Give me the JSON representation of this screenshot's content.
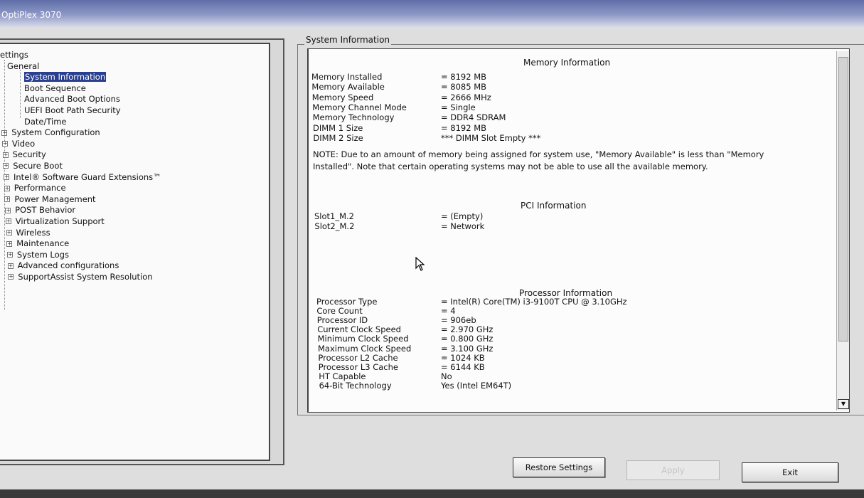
{
  "window": {
    "title": "OptiPlex 3070"
  },
  "tree": {
    "root": "ettings",
    "items": [
      {
        "label": "General",
        "level": 1
      },
      {
        "label": "System Information",
        "level": 2,
        "selected": true
      },
      {
        "label": "Boot Sequence",
        "level": 2
      },
      {
        "label": "Advanced Boot Options",
        "level": 2
      },
      {
        "label": "UEFI Boot Path Security",
        "level": 2
      },
      {
        "label": "Date/Time",
        "level": 2
      },
      {
        "label": "System Configuration",
        "level": 1
      },
      {
        "label": "Video",
        "level": 1
      },
      {
        "label": "Security",
        "level": 1
      },
      {
        "label": "Secure Boot",
        "level": 1
      },
      {
        "label": "Intel® Software Guard Extensions™",
        "level": 1
      },
      {
        "label": "Performance",
        "level": 1
      },
      {
        "label": "Power Management",
        "level": 1
      },
      {
        "label": "POST Behavior",
        "level": 1
      },
      {
        "label": "Virtualization Support",
        "level": 1
      },
      {
        "label": "Wireless",
        "level": 1
      },
      {
        "label": "Maintenance",
        "level": 1
      },
      {
        "label": "System Logs",
        "level": 1
      },
      {
        "label": "Advanced configurations",
        "level": 1
      },
      {
        "label": "SupportAssist System Resolution",
        "level": 1
      }
    ]
  },
  "content": {
    "group_title": "System Information",
    "memory": {
      "title": "Memory Information",
      "rows": [
        {
          "label": "Memory Installed",
          "value": "= 8192 MB"
        },
        {
          "label": "Memory Available",
          "value": "= 8085 MB"
        },
        {
          "label": "Memory Speed",
          "value": "= 2666 MHz"
        },
        {
          "label": "Memory Channel Mode",
          "value": "= Single"
        },
        {
          "label": "Memory Technology",
          "value": "= DDR4 SDRAM"
        },
        {
          "label": "DIMM 1 Size",
          "value": "= 8192 MB"
        },
        {
          "label": "DIMM 2 Size",
          "value": "*** DIMM Slot Empty ***"
        }
      ],
      "note": "NOTE: Due to an amount of memory being assigned for system use, \"Memory Available\" is less than \"Memory Installed\". Note that certain operating systems may not be able to use all the available memory."
    },
    "pci": {
      "title": "PCI Information",
      "rows": [
        {
          "label": "Slot1_M.2",
          "value": "= (Empty)"
        },
        {
          "label": "Slot2_M.2",
          "value": "= Network"
        }
      ]
    },
    "processor": {
      "title": "Processor Information",
      "rows": [
        {
          "label": "Processor Type",
          "value": "= Intel(R) Core(TM) i3-9100T CPU @ 3.10GHz"
        },
        {
          "label": "Core Count",
          "value": "= 4"
        },
        {
          "label": "Processor ID",
          "value": "= 906eb"
        },
        {
          "label": "Current Clock Speed",
          "value": "= 2.970 GHz"
        },
        {
          "label": "Minimum Clock Speed",
          "value": "= 0.800 GHz"
        },
        {
          "label": "Maximum Clock Speed",
          "value": "= 3.100 GHz"
        },
        {
          "label": "Processor L2 Cache",
          "value": "= 1024 KB"
        },
        {
          "label": "Processor L3 Cache",
          "value": "= 6144 KB"
        },
        {
          "label": "HT Capable",
          "value": "No"
        },
        {
          "label": "64-Bit Technology",
          "value": "Yes (Intel EM64T)"
        }
      ]
    }
  },
  "buttons": {
    "restore": "Restore Settings",
    "apply": "Apply",
    "exit": "Exit"
  },
  "colors": {
    "selection": "#2a3f8f",
    "titlebar": "#6f7db3"
  }
}
